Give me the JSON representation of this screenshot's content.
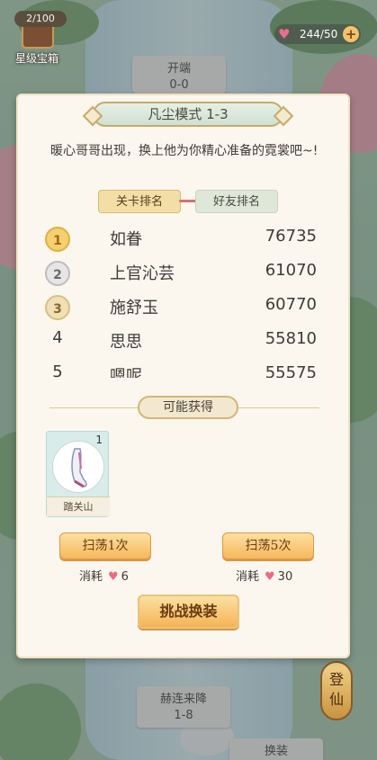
{
  "hud": {
    "chest_count": "2/100",
    "chest_label": "星级宝箱",
    "stamina": "244/50",
    "stamina_icon": "heart-icon",
    "stamina_add_icon": "plus-icon"
  },
  "map": {
    "nodes": [
      {
        "label": "开端",
        "sub": "0-0"
      },
      {
        "label": "赫连来降",
        "sub": "1-8"
      },
      {
        "label": "换装",
        "sub": ""
      }
    ],
    "side_button": "登仙"
  },
  "modal": {
    "title": "凡尘模式 1-3",
    "description": "暖心哥哥出现，换上他为你精心准备的霓裳吧~!",
    "tabs": {
      "stage_rank": "关卡排名",
      "friend_rank": "好友排名"
    },
    "ranking": [
      {
        "rank": "1",
        "name": "如眷",
        "score": "76735",
        "medal": "gold-medal-icon"
      },
      {
        "rank": "2",
        "name": "上官沁芸",
        "score": "61070",
        "medal": "silver-medal-icon"
      },
      {
        "rank": "3",
        "name": "施舒玉",
        "score": "60770",
        "medal": "bronze-medal-icon"
      },
      {
        "rank": "4",
        "name": "思思",
        "score": "55810"
      },
      {
        "rank": "5",
        "name": "嗯呢",
        "score": "55575"
      }
    ],
    "rewards_title": "可能获得",
    "reward_item": {
      "name": "踏关山",
      "qty": "1",
      "icon": "shoe-icon"
    },
    "sweep1": {
      "label": "扫荡1次",
      "cost_label": "消耗",
      "cost": "6"
    },
    "sweep5": {
      "label": "扫荡5次",
      "cost_label": "消耗",
      "cost": "30"
    },
    "challenge": "挑战换装"
  },
  "colors": {
    "accent_gold": "#f6b85c",
    "panel_bg": "#fbf7ee",
    "heart": "#e86d83"
  }
}
